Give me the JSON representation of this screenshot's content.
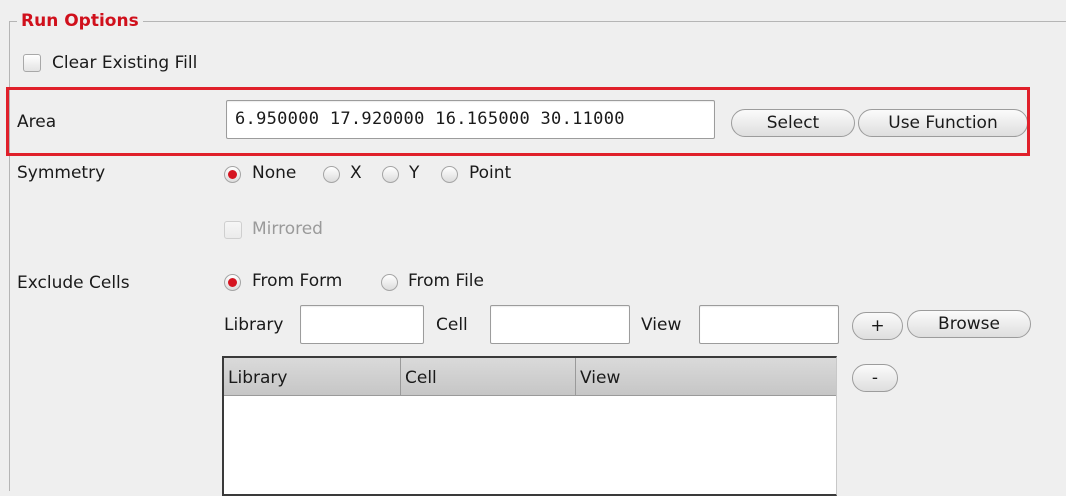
{
  "run_options": {
    "title": "Run Options",
    "clear_existing_fill": {
      "label": "Clear Existing Fill",
      "checked": false
    },
    "area": {
      "label": "Area",
      "value": "6.950000 17.920000 16.165000 30.11000",
      "select_label": "Select",
      "use_function_label": "Use Function",
      "highlight_color": "#e0202a"
    },
    "symmetry": {
      "label": "Symmetry",
      "options": [
        "None",
        "X",
        "Y",
        "Point"
      ],
      "selected": "None",
      "mirrored": {
        "label": "Mirrored",
        "checked": false,
        "enabled": false
      }
    },
    "exclude_cells": {
      "label": "Exclude Cells",
      "options": [
        "From Form",
        "From File"
      ],
      "selected": "From Form",
      "library_label": "Library",
      "library_value": "",
      "cell_label": "Cell",
      "cell_value": "",
      "view_label": "View",
      "view_value": "",
      "add_label": "+",
      "browse_label": "Browse",
      "remove_label": "-",
      "table": {
        "columns": [
          "Library",
          "Cell",
          "View"
        ],
        "rows": []
      }
    }
  },
  "colors": {
    "title_red": "#d0101c",
    "radio_selected": "#d51420",
    "background": "#efefef"
  }
}
